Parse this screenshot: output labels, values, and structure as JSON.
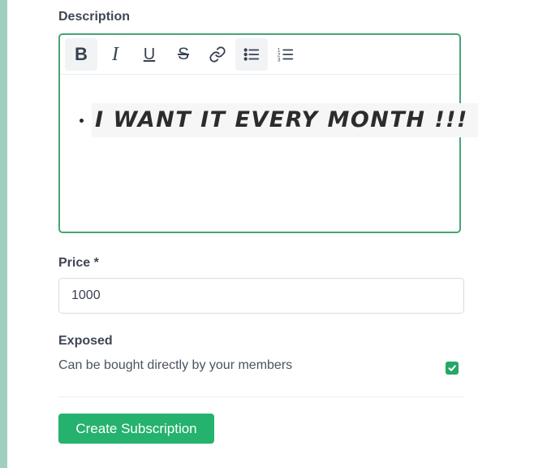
{
  "form": {
    "description": {
      "label": "Description",
      "toolbar": [
        {
          "name": "bold",
          "glyph": "B"
        },
        {
          "name": "italic",
          "glyph": "I"
        },
        {
          "name": "underline",
          "glyph": "U"
        },
        {
          "name": "strikethrough",
          "glyph": "S"
        },
        {
          "name": "link",
          "icon": "link-icon"
        },
        {
          "name": "bullet-list",
          "icon": "bullet-list-icon"
        },
        {
          "name": "ordered-list",
          "icon": "ordered-list-icon"
        }
      ],
      "content_items": [
        "I WANT IT EVERY MONTH !!!"
      ]
    },
    "price": {
      "label": "Price *",
      "value": "1000"
    },
    "exposed": {
      "label": "Exposed",
      "description": "Can be bought directly by your members",
      "checked": true
    },
    "submit_label": "Create Subscription"
  },
  "colors": {
    "accent": "#25b26e",
    "editor_border": "#48a374",
    "left_strip": "#9fd0bd"
  }
}
